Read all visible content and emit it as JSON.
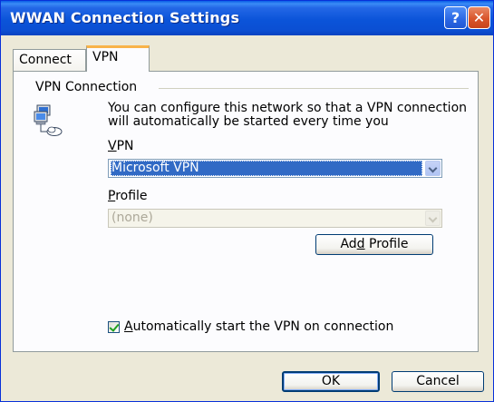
{
  "window": {
    "title": "WWAN Connection Settings",
    "help_glyph": "?",
    "close_glyph": "✕"
  },
  "tabs": [
    {
      "label": "Connect",
      "selected": false
    },
    {
      "label": "VPN",
      "selected": true
    }
  ],
  "vpn_group": {
    "title": "VPN Connection",
    "icon": "network-computer-icon",
    "description": "You can configure this network so that a VPN connection will automatically be started every time you",
    "vpn_label_mnemonic": "V",
    "vpn_label_rest": "PN",
    "vpn_value": "Microsoft VPN",
    "profile_label_mnemonic": "P",
    "profile_label_rest": "rofile",
    "profile_value": "(none)",
    "add_profile_pre": "Ad",
    "add_profile_mnemonic": "d",
    "add_profile_post": " Profile",
    "auto_start_checked": true,
    "auto_start_mnemonic": "A",
    "auto_start_rest": "utomatically start the VPN on connection"
  },
  "buttons": {
    "ok": "OK",
    "cancel": "Cancel"
  },
  "colors": {
    "title_bar": "#0b54d9",
    "selection": "#316ac5",
    "tab_highlight": "#f8b349",
    "dialog_bg": "#ece9d8"
  }
}
